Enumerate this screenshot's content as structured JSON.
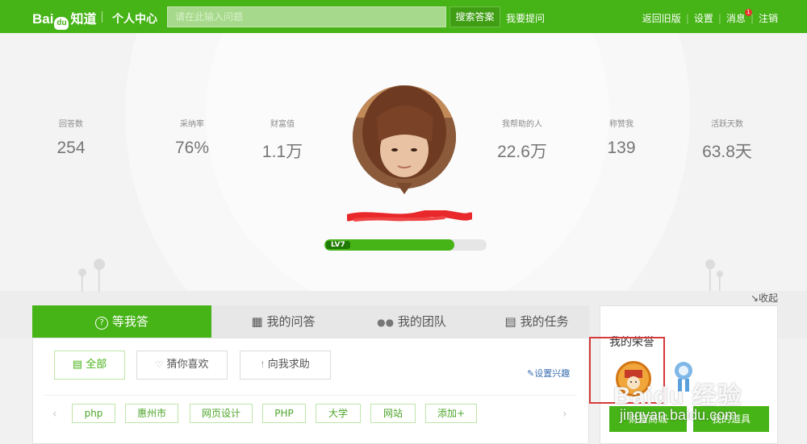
{
  "header": {
    "logo_text": "Bai",
    "logo_paw": "du",
    "logo_suffix": "知道",
    "center_title": "个人中心",
    "search_placeholder": "请在此输入问题",
    "search_button": "搜索答案",
    "ask_link": "我要提问",
    "nav": [
      "返回旧版",
      "设置",
      "消息",
      "注销"
    ],
    "message_badge": "1"
  },
  "profile": {
    "stats_left": [
      {
        "label": "回答数",
        "value": "254"
      },
      {
        "label": "采纳率",
        "value": "76%"
      },
      {
        "label": "财富值",
        "value": "1.1万"
      }
    ],
    "stats_right": [
      {
        "label": "我帮助的人",
        "value": "22.6万"
      },
      {
        "label": "称赞我",
        "value": "139"
      },
      {
        "label": "活跃天数",
        "value": "63.8天"
      }
    ],
    "level_label": "LV7",
    "level_progress": 0.8,
    "collapse_label": "↘收起",
    "avatar_icon": "user-avatar"
  },
  "tabs": [
    {
      "icon": "question-icon",
      "glyph": "?",
      "label": "等我答",
      "active": true
    },
    {
      "icon": "grid-icon",
      "glyph": "▦",
      "label": "我的问答",
      "active": false
    },
    {
      "icon": "team-icon",
      "glyph": "👥",
      "label": "我的团队",
      "active": false
    },
    {
      "icon": "calendar-icon",
      "glyph": "▤",
      "label": "我的任务",
      "active": false
    }
  ],
  "filters": [
    {
      "glyph": "▤",
      "label": "全部"
    },
    {
      "glyph": "♡",
      "label": "猜你喜欢"
    },
    {
      "glyph": "!",
      "label": "向我求助"
    }
  ],
  "interest_link": "✎设置兴趣",
  "tags": [
    "php",
    "惠州市",
    "网页设计",
    "PHP",
    "大学",
    "网站",
    "添加+"
  ],
  "honor": {
    "title": "我的荣誉",
    "button_left": "财富商城",
    "button_right": "我的道具"
  },
  "watermark": {
    "top": "Baidu 经验",
    "bottom": "jingyan.baidu.com"
  },
  "colors": {
    "brand_green": "#46b317",
    "highlight_red": "#d63a3a"
  }
}
